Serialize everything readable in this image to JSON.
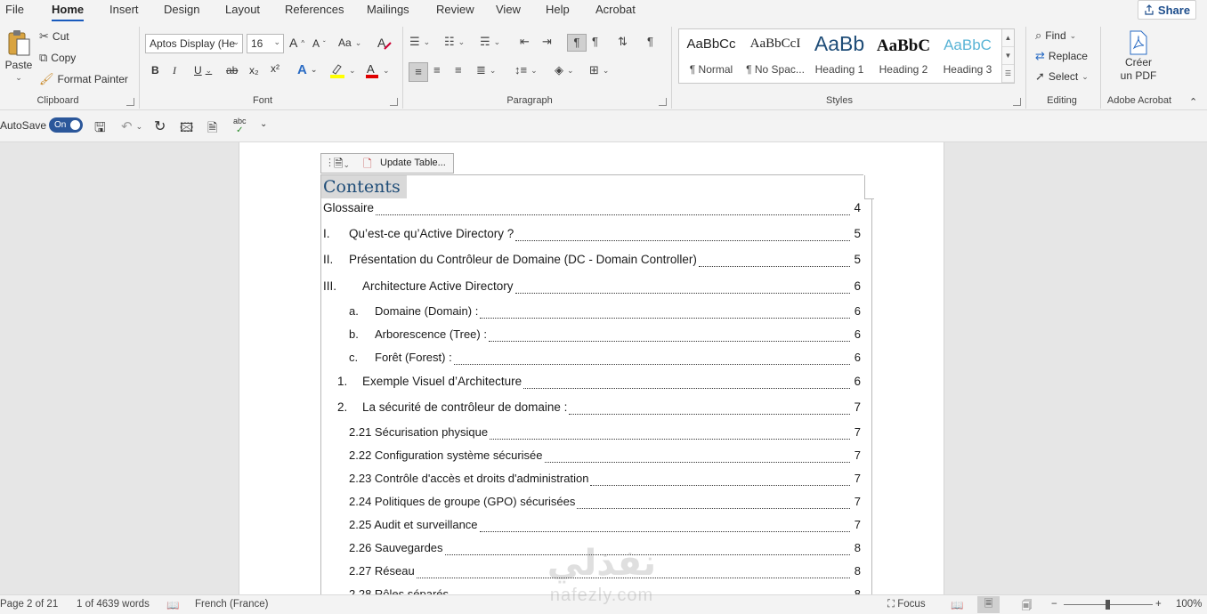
{
  "tabs": [
    "File",
    "Home",
    "Insert",
    "Design",
    "Layout",
    "References",
    "Mailings",
    "Review",
    "View",
    "Help",
    "Acrobat"
  ],
  "active_tab": "Home",
  "share_label": "Share",
  "clipboard": {
    "paste": "Paste",
    "cut": "Cut",
    "copy": "Copy",
    "format_painter": "Format Painter",
    "label": "Clipboard"
  },
  "font": {
    "name": "Aptos Display (He",
    "size": "16",
    "label": "Font",
    "case_btn": "Aa",
    "bold": "B",
    "italic": "I",
    "strike": "ab",
    "sub": "x₂",
    "sup": "x²",
    "grow": "A",
    "shrink": "A"
  },
  "paragraph": {
    "label": "Paragraph"
  },
  "styles": {
    "label": "Styles",
    "items": [
      {
        "sample": "AaBbCc",
        "name": "¶ Normal"
      },
      {
        "sample": "AaBbCcI",
        "name": "¶ No Spac..."
      },
      {
        "sample": "AaBb",
        "name": "Heading 1"
      },
      {
        "sample": "AaBbC",
        "name": "Heading 2"
      },
      {
        "sample": "AaBbC",
        "name": "Heading 3"
      }
    ]
  },
  "editing": {
    "find": "Find",
    "replace": "Replace",
    "select": "Select",
    "label": "Editing"
  },
  "acrobat": {
    "create_pdf_line1": "Créer",
    "create_pdf_line2": "un PDF",
    "label": "Adobe Acrobat"
  },
  "qat": {
    "autosave": "AutoSave",
    "toggle": "On"
  },
  "toc": {
    "update_label": "Update Table...",
    "title": "Contents",
    "entries": [
      {
        "num": "",
        "text": "Glossaire",
        "page": "4"
      },
      {
        "num": "I.",
        "text": "Qu’est-ce qu’Active Directory ?",
        "page": "5"
      },
      {
        "num": "II.",
        "text": "Présentation du Contrôleur de Domaine (DC - Domain Controller)",
        "page": "5"
      },
      {
        "num": "III.",
        "text": "Architecture Active Directory",
        "page": "6"
      },
      {
        "num": "a.",
        "text": "Domaine (Domain) :",
        "page": "6"
      },
      {
        "num": "b.",
        "text": "Arborescence (Tree) :",
        "page": "6"
      },
      {
        "num": "c.",
        "text": "Forêt (Forest) :",
        "page": "6"
      },
      {
        "num": "1.",
        "text": "Exemple Visuel d’Architecture",
        "page": "6"
      },
      {
        "num": "2.",
        "text": "La sécurité de contrôleur de domaine :",
        "page": "7"
      },
      {
        "num": "",
        "text": "2.21 Sécurisation physique",
        "page": "7"
      },
      {
        "num": "",
        "text": "2.22 Configuration système sécurisée",
        "page": "7"
      },
      {
        "num": "",
        "text": "2.23 Contrôle d'accès et droits d'administration",
        "page": "7"
      },
      {
        "num": "",
        "text": "2.24 Politiques de groupe (GPO) sécurisées",
        "page": "7"
      },
      {
        "num": "",
        "text": "2.25 Audit et surveillance",
        "page": "7"
      },
      {
        "num": "",
        "text": "2.26 Sauvegardes",
        "page": "8"
      },
      {
        "num": "",
        "text": "2.27 Réseau",
        "page": "8"
      },
      {
        "num": "",
        "text": "2.28 Rôles séparés",
        "page": "8"
      }
    ]
  },
  "watermark": {
    "arabic": "نفذلي",
    "latin": "nafezly.com"
  },
  "status": {
    "page": "Page 2 of 21",
    "words": "1 of 4639 words",
    "language": "French (France)",
    "focus": "Focus",
    "zoom": "100%",
    "zoom_level": 1.0
  },
  "colors": {
    "accent": "#185abd",
    "heading": "#1f4d78",
    "highlight": "#ffff00",
    "font_color": "#e00000"
  }
}
